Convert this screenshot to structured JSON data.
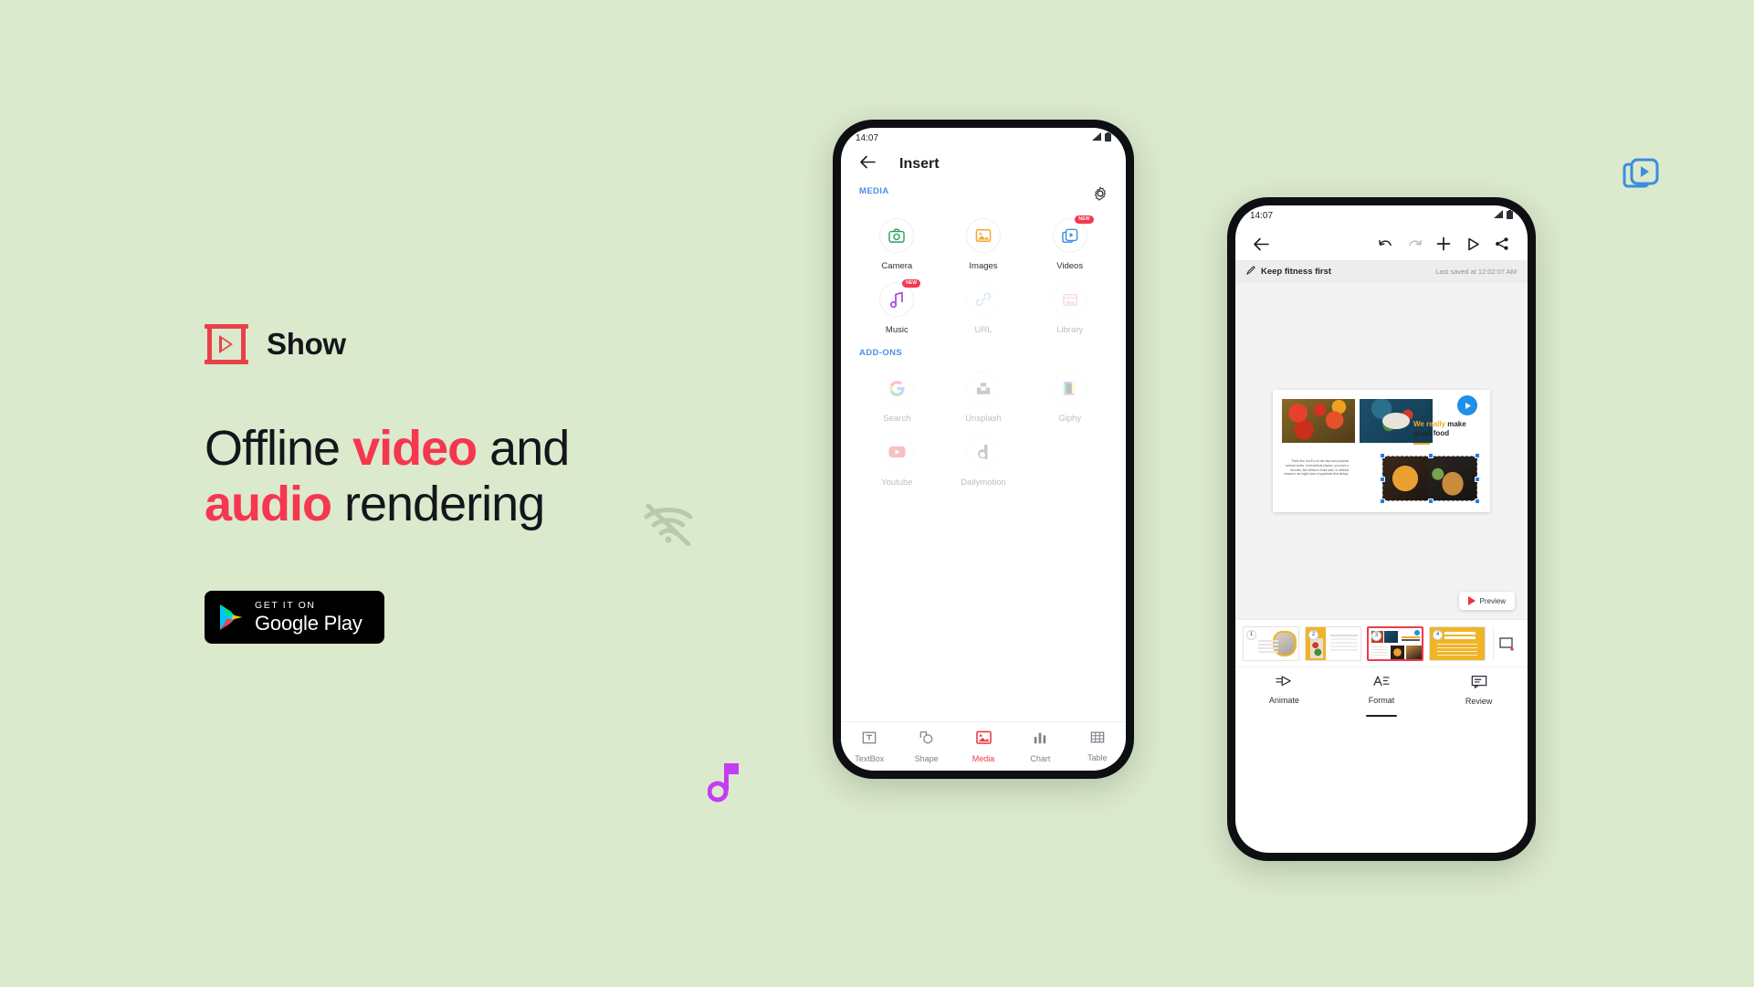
{
  "theme": {
    "background": "#dbe9cd",
    "accent_red": "#f5374f",
    "brand_red": "#e8414a",
    "blue": "#4a90e2",
    "orange": "#f0a925",
    "purple": "#c33ef0"
  },
  "promo": {
    "brand_name": "Show",
    "brand_logo_icon": "play-frame-icon",
    "headline_parts": [
      {
        "text": "Offline ",
        "highlight": false
      },
      {
        "text": "video",
        "highlight": true
      },
      {
        "text": " and ",
        "highlight": false
      },
      {
        "text": "audio",
        "highlight": true
      },
      {
        "text": " rendering",
        "highlight": false
      }
    ],
    "headline_plain": "Offline video and audio rendering",
    "store_badge": {
      "small_text": "GET IT ON",
      "big_text": "Google Play",
      "icon": "google-play-triangle-icon"
    }
  },
  "decorations": [
    {
      "name": "wifi-off-icon",
      "color": "#8a9b7e"
    },
    {
      "name": "music-note-icon",
      "color": "#c33ef0"
    },
    {
      "name": "video-stack-icon",
      "color": "#2f8fe8"
    }
  ],
  "phone_insert": {
    "status_bar": {
      "time": "14:07",
      "signal_icon": "signal-icon",
      "battery_icon": "battery-icon"
    },
    "header": {
      "back_icon": "back-arrow-icon",
      "title": "Insert",
      "settings_icon": "gear-icon"
    },
    "sections": [
      {
        "label": "MEDIA",
        "items": [
          {
            "label": "Camera",
            "icon": "camera-icon",
            "color": "#2e9e5b",
            "enabled": true,
            "badge": ""
          },
          {
            "label": "Images",
            "icon": "image-icon",
            "color": "#f3a82a",
            "enabled": true,
            "badge": ""
          },
          {
            "label": "Videos",
            "icon": "video-icon",
            "color": "#3a8ede",
            "enabled": true,
            "badge": "NEW"
          },
          {
            "label": "Music",
            "icon": "music-note-icon",
            "color": "#a24ae0",
            "enabled": true,
            "badge": "NEW"
          },
          {
            "label": "URL",
            "icon": "link-icon",
            "color": "#6fb3e8",
            "enabled": false,
            "badge": ""
          },
          {
            "label": "Library",
            "icon": "library-icon",
            "color": "#e8928f",
            "enabled": false,
            "badge": ""
          }
        ]
      },
      {
        "label": "ADD-ONS",
        "items": [
          {
            "label": "Search",
            "icon": "google-g-icon",
            "color": "#4285f4",
            "enabled": false,
            "badge": ""
          },
          {
            "label": "Unsplash",
            "icon": "unsplash-icon",
            "color": "#555555",
            "enabled": false,
            "badge": ""
          },
          {
            "label": "Giphy",
            "icon": "giphy-icon",
            "color": "#9b59d0",
            "enabled": false,
            "badge": ""
          },
          {
            "label": "Youtube",
            "icon": "youtube-icon",
            "color": "#e8323c",
            "enabled": false,
            "badge": ""
          },
          {
            "label": "Dailymotion",
            "icon": "dailymotion-icon",
            "color": "#4a4f56",
            "enabled": false,
            "badge": ""
          }
        ]
      }
    ],
    "bottom_nav": [
      {
        "label": "TextBox",
        "icon": "textbox-icon",
        "active": false
      },
      {
        "label": "Shape",
        "icon": "shape-icon",
        "active": false
      },
      {
        "label": "Media",
        "icon": "media-icon",
        "active": true
      },
      {
        "label": "Chart",
        "icon": "chart-icon",
        "active": false
      },
      {
        "label": "Table",
        "icon": "table-icon",
        "active": false
      }
    ]
  },
  "phone_editor": {
    "status_bar": {
      "time": "14:07",
      "signal_icon": "signal-icon",
      "battery_icon": "battery-icon"
    },
    "toolbar": [
      {
        "name": "back-arrow-icon",
        "enabled": true
      },
      {
        "name": "undo-icon",
        "enabled": true
      },
      {
        "name": "redo-icon",
        "enabled": false
      },
      {
        "name": "add-icon",
        "enabled": true
      },
      {
        "name": "play-icon",
        "enabled": true
      },
      {
        "name": "share-icon",
        "enabled": true
      }
    ],
    "document": {
      "title": "Keep fitness first",
      "edit_icon": "pencil-icon",
      "saved_status": "Last saved at 12:02:07 AM"
    },
    "slide": {
      "heading_orange": "We really",
      "heading_dark": "make good food",
      "body_text": "That's fine, but it's not the way most physical science works. In theoretical physics, you have a theories, like Newton's three laws. In medical research, we might have a hypothesis that dietary.",
      "play_button_icon": "play-circle-icon"
    },
    "preview_button": {
      "label": "Preview",
      "icon": "play-triangle-icon"
    },
    "thumbnails": [
      {
        "number": "1",
        "selected": false
      },
      {
        "number": "2",
        "selected": false
      },
      {
        "number": "3",
        "selected": true
      },
      {
        "number": "4",
        "selected": false
      }
    ],
    "add_slide_icon": "add-slide-icon",
    "bottom_nav": [
      {
        "label": "Animate",
        "icon": "animate-icon",
        "active": false
      },
      {
        "label": "Format",
        "icon": "format-icon",
        "active": true
      },
      {
        "label": "Review",
        "icon": "review-icon",
        "active": false
      }
    ]
  }
}
